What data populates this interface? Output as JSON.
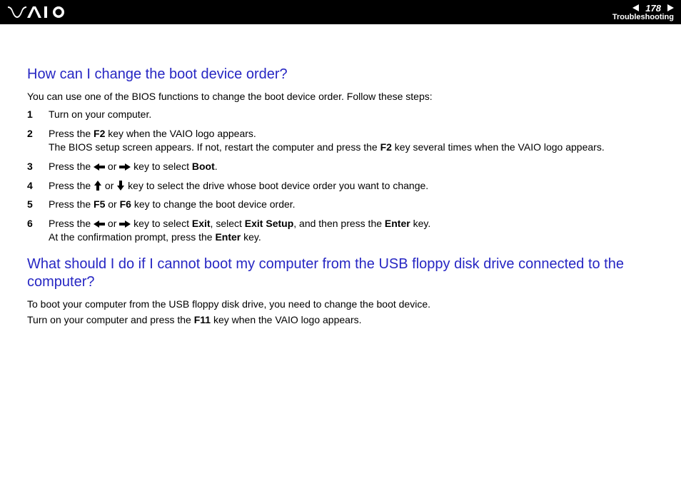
{
  "header": {
    "page_number": "178",
    "section": "Troubleshooting"
  },
  "section1": {
    "heading": "How can I change the boot device order?",
    "intro": "You can use one of the BIOS functions to change the boot device order. Follow these steps:",
    "steps": {
      "s1": "Turn on your computer.",
      "s2a": "Press the ",
      "s2b": "F2",
      "s2c": " key when the VAIO logo appears.",
      "s2d": "The BIOS setup screen appears. If not, restart the computer and press the ",
      "s2e": "F2",
      "s2f": " key several times when the VAIO logo appears.",
      "s3a": "Press the ",
      "s3b": " or ",
      "s3c": " key to select ",
      "s3d": "Boot",
      "s3e": ".",
      "s4a": "Press the ",
      "s4b": " or ",
      "s4c": " key to select the drive whose boot device order you want to change.",
      "s5a": "Press the ",
      "s5b": "F5",
      "s5c": " or ",
      "s5d": "F6",
      "s5e": " key to change the boot device order.",
      "s6a": "Press the ",
      "s6b": " or ",
      "s6c": " key to select ",
      "s6d": "Exit",
      "s6e": ", select ",
      "s6f": "Exit Setup",
      "s6g": ", and then press the ",
      "s6h": "Enter",
      "s6i": " key.",
      "s6j": "At the confirmation prompt, press the ",
      "s6k": "Enter",
      "s6l": " key."
    }
  },
  "section2": {
    "heading": "What should I do if I cannot boot my computer from the USB floppy disk drive connected to the computer?",
    "p1": "To boot your computer from the USB floppy disk drive, you need to change the boot device.",
    "p2a": "Turn on your computer and press the ",
    "p2b": "F11",
    "p2c": " key when the VAIO logo appears."
  }
}
